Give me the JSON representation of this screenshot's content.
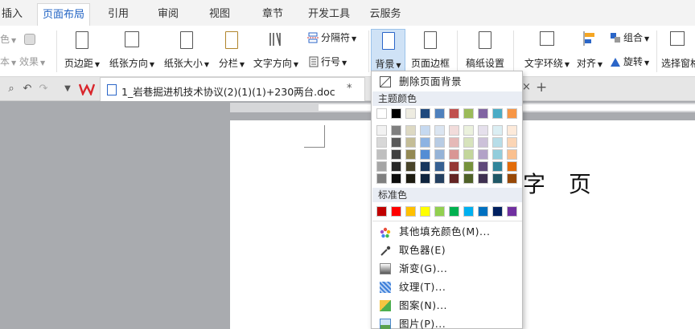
{
  "menu": {
    "tabs": [
      {
        "label": "插入"
      },
      {
        "label": "页面布局"
      },
      {
        "label": "引用"
      },
      {
        "label": "审阅"
      },
      {
        "label": "视图"
      },
      {
        "label": "章节"
      },
      {
        "label": "开发工具"
      },
      {
        "label": "云服务"
      }
    ]
  },
  "ribbon": {
    "partial_left": {
      "color_label": "色",
      "text_label": "本",
      "effect_label": "效果"
    },
    "margins": "页边距",
    "orientation": "纸张方向",
    "size": "纸张大小",
    "columns": "分栏",
    "text_direction": "文字方向",
    "separator": "分隔符",
    "line_numbers": "行号",
    "background": "背景",
    "page_border": "页面边框",
    "manuscript": "稿纸设置",
    "text_wrap": "文字环绕",
    "align": "对齐",
    "group": "组合",
    "rotate": "旋转",
    "select_pane": "选择窗格"
  },
  "tabbar": {
    "doc_title": "1_岩巷掘进机技术协议(2)(1)(1)+230两台.doc",
    "close_glyph": "×",
    "star": "*",
    "add_glyph": "+"
  },
  "page": {
    "text": "字 页"
  },
  "dropdown": {
    "remove_bg": "删除页面背景",
    "theme_header": "主题颜色",
    "standard_header": "标准色",
    "theme_top": [
      "#ffffff",
      "#000000",
      "#eeece1",
      "#1f497d",
      "#4f81bd",
      "#c0504d",
      "#9bbb59",
      "#8064a2",
      "#4bacc6",
      "#f79646"
    ],
    "theme_rows": [
      [
        "#f2f2f2",
        "#7f7f7f",
        "#ddd9c3",
        "#c6d9f0",
        "#dbe5f1",
        "#f2dcdb",
        "#ebf1dd",
        "#e5e0ec",
        "#dbeef3",
        "#fdeada"
      ],
      [
        "#d8d8d8",
        "#595959",
        "#c4bd97",
        "#8db3e2",
        "#b8cce4",
        "#e5b9b7",
        "#d7e3bc",
        "#ccc1d9",
        "#b7dde8",
        "#fbd5b5"
      ],
      [
        "#bfbfbf",
        "#3f3f3f",
        "#938953",
        "#548dd4",
        "#95b3d7",
        "#d99694",
        "#c3d69b",
        "#b2a2c7",
        "#92cddc",
        "#fac08f"
      ],
      [
        "#a5a5a5",
        "#262626",
        "#494429",
        "#17365d",
        "#366092",
        "#953734",
        "#76923c",
        "#5f497a",
        "#31859b",
        "#e36c09"
      ],
      [
        "#7f7f7f",
        "#0c0c0c",
        "#1d1b10",
        "#0f243e",
        "#244061",
        "#632423",
        "#4f6128",
        "#3f3151",
        "#205867",
        "#974806"
      ]
    ],
    "standard": [
      "#c00000",
      "#ff0000",
      "#ffc000",
      "#ffff00",
      "#92d050",
      "#00b050",
      "#00b0f0",
      "#0070c0",
      "#002060",
      "#7030a0"
    ],
    "more_colors": "其他填充颜色(M)...",
    "eyedropper": "取色器(E)",
    "gradient": "渐变(G)...",
    "texture": "纹理(T)...",
    "pattern": "图案(N)...",
    "picture": "图片(P)..."
  }
}
